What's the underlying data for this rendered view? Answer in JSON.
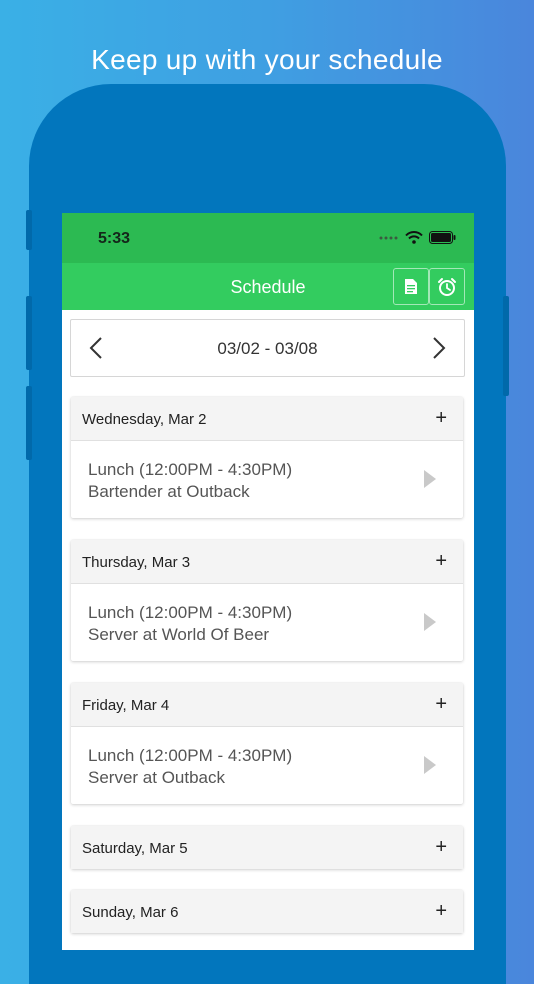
{
  "headline": "Keep up with your schedule",
  "status_bar": {
    "time": "5:33"
  },
  "nav": {
    "title": "Schedule"
  },
  "icons": {
    "left_arrow": "chevron-left-icon",
    "right_arrow": "chevron-right-icon",
    "document": "document-icon",
    "alarm": "alarm-clock-icon",
    "add": "plus-icon",
    "shift_open": "play-triangle-icon"
  },
  "colors": {
    "status_bar": "#2cba52",
    "nav_bar": "#33cc5f",
    "phone_body": "#0276bd"
  },
  "week": {
    "range": "03/02 - 03/08"
  },
  "days": [
    {
      "label": "Wednesday, Mar 2",
      "add": "+",
      "shift": {
        "time": "Lunch (12:00PM - 4:30PM)",
        "role": "Bartender at Outback"
      }
    },
    {
      "label": "Thursday, Mar 3",
      "add": "+",
      "shift": {
        "time": "Lunch (12:00PM - 4:30PM)",
        "role": "Server at World Of Beer"
      }
    },
    {
      "label": "Friday, Mar 4",
      "add": "+",
      "shift": {
        "time": "Lunch (12:00PM - 4:30PM)",
        "role": "Server at Outback"
      }
    },
    {
      "label": "Saturday, Mar 5",
      "add": "+"
    },
    {
      "label": "Sunday, Mar 6",
      "add": "+"
    }
  ]
}
